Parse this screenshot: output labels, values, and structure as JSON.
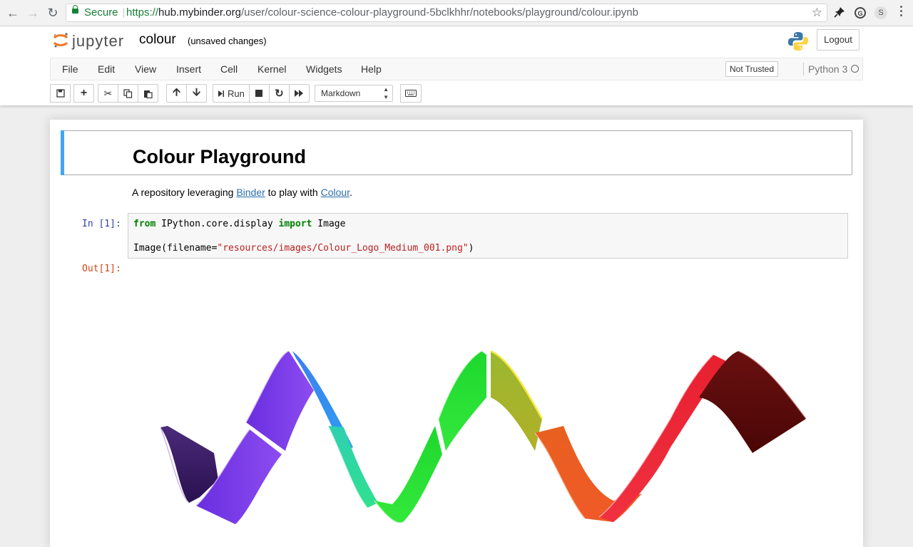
{
  "browser": {
    "secure_label": "Secure",
    "url_scheme": "https://",
    "url_host": "hub.mybinder.org",
    "url_path": "/user/colour-science-colour-playground-5bclkhhr/notebooks/playground/colour.ipynb",
    "extension_s_label": "S"
  },
  "header": {
    "logo_text": "jupyter",
    "notebook_name": "colour",
    "save_status": "(unsaved changes)",
    "logout_label": "Logout"
  },
  "menubar": {
    "items": [
      "File",
      "Edit",
      "View",
      "Insert",
      "Cell",
      "Kernel",
      "Widgets",
      "Help"
    ],
    "trust_label": "Not Trusted",
    "kernel_name": "Python 3"
  },
  "toolbar": {
    "run_label": "Run",
    "cell_type": "Markdown"
  },
  "notebook": {
    "heading": "Colour Playground",
    "intro_prefix": "A repository leveraging ",
    "link_binder": "Binder",
    "intro_middle": " to play with ",
    "link_colour": "Colour",
    "intro_suffix": ".",
    "in_prompt": "In [1]:",
    "code": {
      "line1_kw1": "from",
      "line1_mod": " IPython.core.display ",
      "line1_kw2": "import",
      "line1_name": " Image",
      "line2_call": "Image(filename=",
      "line2_str": "\"resources/images/Colour_Logo_Medium_001.png\"",
      "line2_end": ")"
    },
    "out_prompt": "Out[1]:"
  },
  "colors": {
    "selected_cell_bar": "#42a5f5",
    "secure_green": "#188038",
    "keyword_green": "#008000",
    "string_red": "#ba2121",
    "in_prompt_blue": "#303f9f",
    "out_prompt_red": "#d84315"
  }
}
